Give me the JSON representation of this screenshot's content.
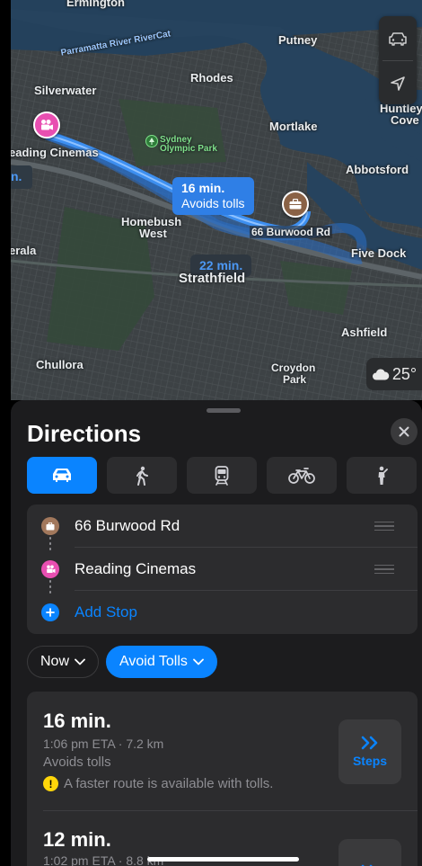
{
  "map": {
    "labels": {
      "ermington": "Ermington",
      "river": "Parramatta River RiverCat",
      "putney": "Putney",
      "rhodes": "Rhodes",
      "silverwater": "Silverwater",
      "huntley": "Huntley",
      "cove": "Cove",
      "mortlake": "Mortlake",
      "sydney_olympic": "Sydney",
      "olympic_park": "Olympic Park",
      "reading_cinemas": "eading Cinemas",
      "abbotsford": "Abbotsford",
      "homebush": "Homebush",
      "west": "West",
      "burwood": "66 Burwood Rd",
      "five_dock": "Five Dock",
      "erala": "erala",
      "strathfield": "Strathfield",
      "ashfield": "Ashfield",
      "chullora": "Chullora",
      "croydon": "Croydon",
      "park": "Park",
      "edge_n": "n."
    },
    "callout_primary": {
      "time": "16 min.",
      "note": "Avoids tolls"
    },
    "callout_alt": {
      "time": "22 min."
    },
    "weather": {
      "temp": "25°",
      "icon": "cloud-icon"
    },
    "controls": {
      "transport_icon": "car-icon",
      "location_icon": "location-arrow-icon"
    }
  },
  "sheet": {
    "title": "Directions",
    "modes": [
      {
        "name": "drive",
        "icon": "car-icon",
        "active": true
      },
      {
        "name": "walk",
        "icon": "walk-icon",
        "active": false
      },
      {
        "name": "transit",
        "icon": "train-icon",
        "active": false
      },
      {
        "name": "cycle",
        "icon": "bicycle-icon",
        "active": false
      },
      {
        "name": "rideshare",
        "icon": "person-icon",
        "active": false
      }
    ],
    "stops": [
      {
        "label": "66 Burwood Rd",
        "color": "#a2785c"
      },
      {
        "label": "Reading Cinemas",
        "color": "#e84fb1"
      }
    ],
    "add_stop": "Add Stop",
    "options": {
      "time": "Now",
      "avoid": "Avoid Tolls"
    },
    "routes": [
      {
        "time": "16 min.",
        "eta": "1:06 pm ETA · 7.2 km",
        "note": "Avoids tolls",
        "warning": "A faster route is available with tolls.",
        "steps": "Steps"
      },
      {
        "time": "12 min.",
        "eta": "1:02 pm ETA · 8.8 km"
      }
    ]
  },
  "colors": {
    "accent": "#0a84ff",
    "route": "#3d8ff0",
    "warning": "#ffd60a"
  }
}
